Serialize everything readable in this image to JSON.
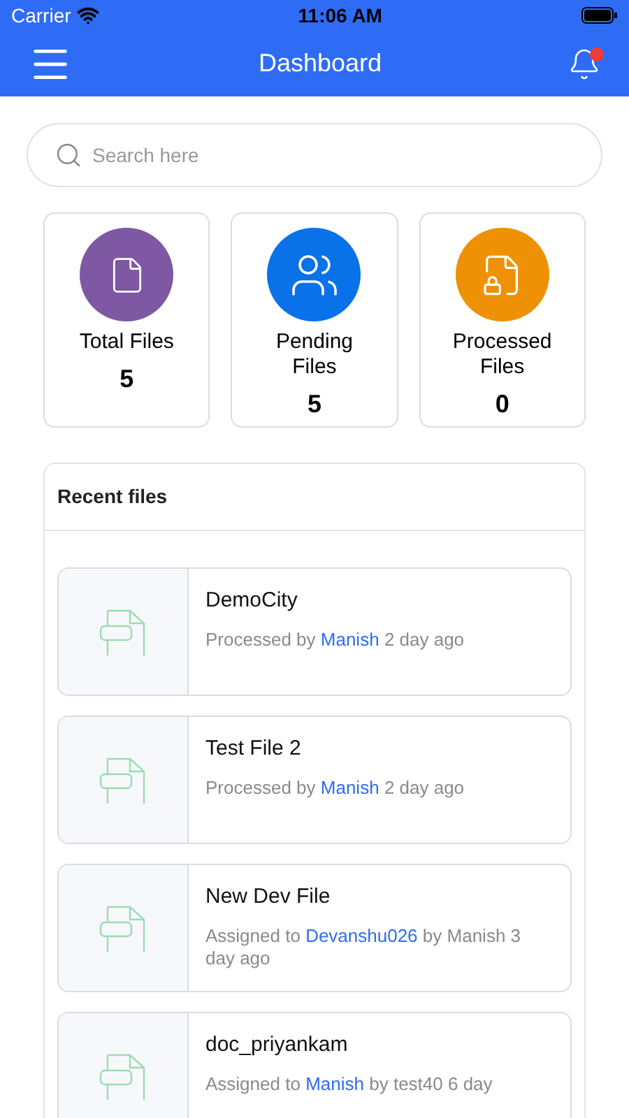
{
  "status_bar": {
    "carrier": "Carrier",
    "time": "11:06 AM"
  },
  "header": {
    "title": "Dashboard",
    "notification_badge": true
  },
  "search": {
    "placeholder": "Search here"
  },
  "stats": [
    {
      "kind": "file",
      "label": "Total Files",
      "value": "5",
      "color": "#7f58a4"
    },
    {
      "kind": "users",
      "label": "Pending Files",
      "value": "5",
      "color": "#0a72e8"
    },
    {
      "kind": "locked",
      "label": "Processed Files",
      "value": "0",
      "color": "#ee9105"
    }
  ],
  "recent": {
    "title": "Recent files",
    "items": [
      {
        "name": "DemoCity",
        "before": "Processed by",
        "link": "Manish",
        "after": "2 day ago"
      },
      {
        "name": "Test File 2",
        "before": "Processed by",
        "link": "Manish",
        "after": "2 day ago"
      },
      {
        "name": "New Dev File",
        "before": "Assigned to",
        "link": "Devanshu026",
        "after": "by Manish 3 day ago"
      },
      {
        "name": "doc_priyankam",
        "before": "Assigned to",
        "link": "Manish",
        "after": "by test40 6 day"
      }
    ]
  }
}
